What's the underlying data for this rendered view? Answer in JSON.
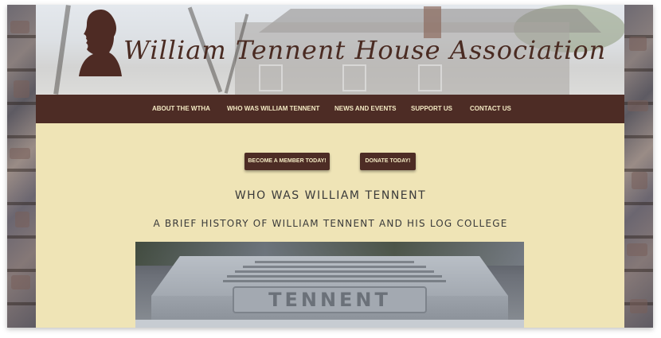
{
  "site": {
    "logo_text": "William Tennent House Association"
  },
  "nav": {
    "items": [
      {
        "label": "ABOUT THE WTHA"
      },
      {
        "label": "WHO WAS WILLIAM TENNENT"
      },
      {
        "label": "NEWS AND EVENTS"
      },
      {
        "label": "SUPPORT US"
      },
      {
        "label": "CONTACT US"
      }
    ]
  },
  "actions": {
    "member_label": "BECOME A MEMBER TODAY!",
    "donate_label": "DONATE TODAY!"
  },
  "main": {
    "title": "WHO WAS WILLIAM TENNENT",
    "subtitle": "A BRIEF HISTORY OF WILLIAM TENNENT AND HIS LOG COLLEGE",
    "photo_caption_engraving": "TENNENT"
  },
  "colors": {
    "brand_brown": "#4d2c25",
    "page_cream": "#efe4b6",
    "nav_text": "#f3e9c3"
  }
}
